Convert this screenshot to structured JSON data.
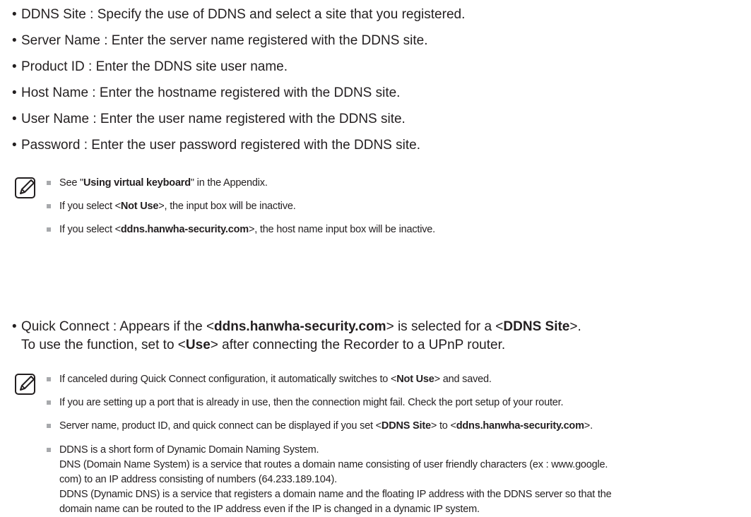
{
  "bullets": [
    {
      "label": "DDNS Site",
      "text": "Specify the use of DDNS and select a site that you registered."
    },
    {
      "label": "Server Name",
      "text": "Enter the server name registered with the DDNS site."
    },
    {
      "label": "Product ID",
      "text": "Enter the DDNS site user name."
    },
    {
      "label": "Host Name",
      "text": "Enter the hostname registered with the DDNS site."
    },
    {
      "label": "User Name",
      "text": "Enter the user name registered with the DDNS site."
    },
    {
      "label": "Password",
      "text": "Enter the user password registered with the DDNS site."
    }
  ],
  "bullet_separator": " : ",
  "bullet_char": "•",
  "note1": {
    "icon": "note-pencil-icon",
    "items": [
      {
        "pre": "See \"",
        "bold": "Using virtual keyboard",
        "post": "\" in the Appendix."
      },
      {
        "pre": "If you select <",
        "bold": "Not Use",
        "post": ">, the input box will be inactive."
      },
      {
        "pre": "If you select <",
        "bold": "ddns.hanwha-security.com",
        "post": ">, the host name input box will be inactive."
      }
    ]
  },
  "quick_connect": {
    "label": "Quick Connect",
    "line1_pre": "Appears if the <",
    "line1_bold1": "ddns.hanwha-security.com",
    "line1_mid": "> is selected for a <",
    "line1_bold2": "DDNS Site",
    "line1_post": ">.",
    "line2_pre": "To use the function, set to <",
    "line2_bold": "Use",
    "line2_post": "> after connecting the Recorder to a UPnP router."
  },
  "note2": {
    "icon": "note-pencil-icon",
    "item1_pre": "If canceled during Quick Connect configuration, it automatically switches to <",
    "item1_bold": "Not Use",
    "item1_post": "> and saved.",
    "item2": "If you are setting up a port that is already in use, then the connection might fail. Check the port setup of your router.",
    "item3_pre": "Server name, product ID, and quick connect can be displayed if you set <",
    "item3_bold1": "DDNS Site",
    "item3_mid": "> to <",
    "item3_bold2": "ddns.hanwha-security.com",
    "item3_post": ">.",
    "item4_lines": [
      "DDNS is a short form of Dynamic Domain Naming System.",
      "DNS (Domain Name System) is a service that routes a domain name consisting of user friendly characters (ex : www.google.",
      "com) to an IP address consisting of numbers (64.233.189.104).",
      "DDNS (Dynamic DNS) is a service that registers a domain name and the floating IP address with the DDNS server so that the",
      "domain name can be routed to the IP address even if the IP is changed in a dynamic IP system."
    ]
  }
}
